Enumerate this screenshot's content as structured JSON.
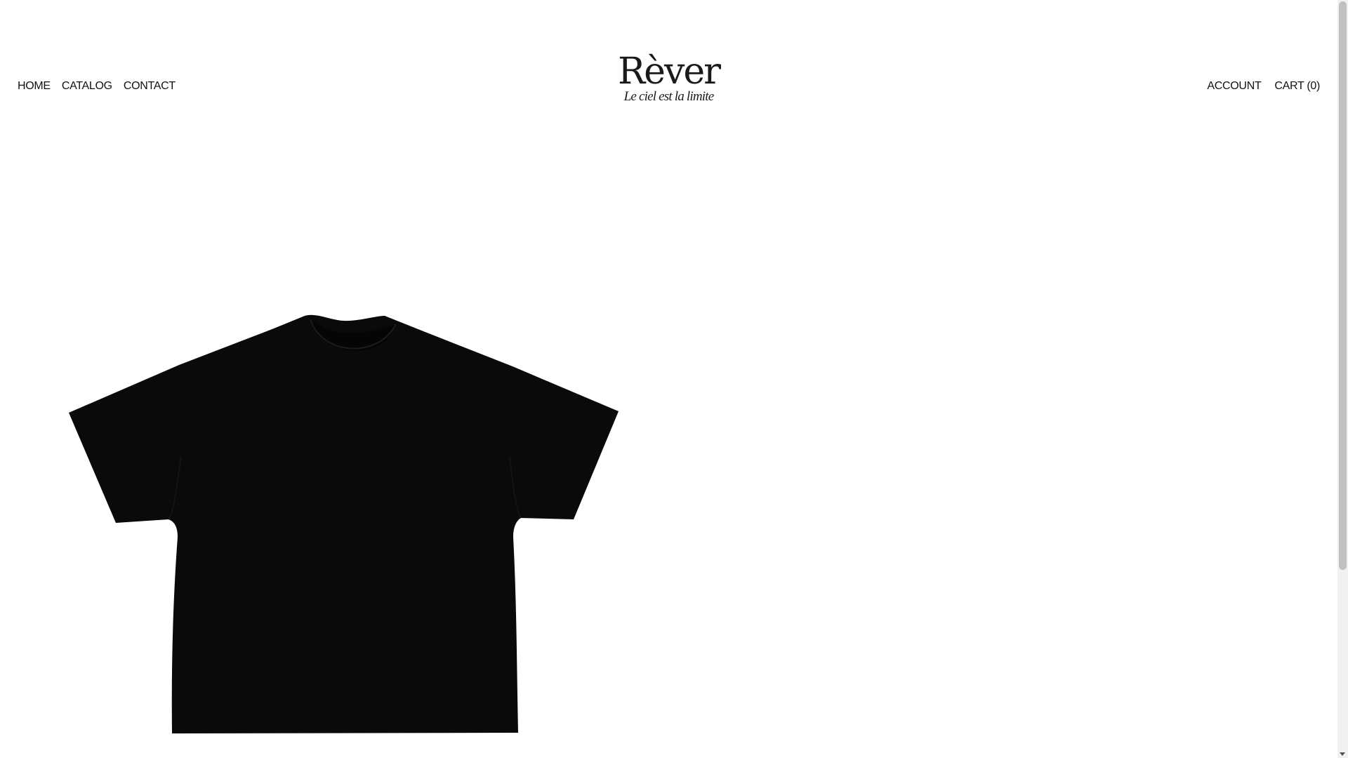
{
  "nav_left": {
    "home": "HOME",
    "catalog": "CATALOG",
    "contact": "CONTACT"
  },
  "nav_right": {
    "account": "ACCOUNT",
    "cart": "CART (0)"
  },
  "logo": {
    "title": "Rèver",
    "tagline": "Le ciel est la limite"
  },
  "product": {
    "image_icon": "black-tshirt-image",
    "color": "#0a0a0a"
  },
  "colors": {
    "background": "#ffffff",
    "text": "#111111"
  }
}
